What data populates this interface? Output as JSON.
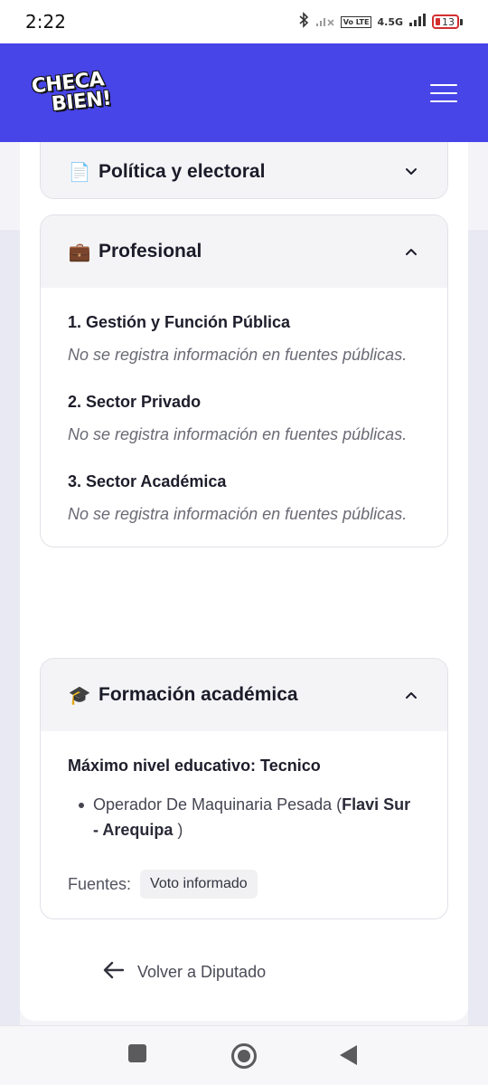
{
  "status_bar": {
    "time": "2:22",
    "bluetooth_icon": "bluetooth-icon",
    "volte_label": "Vo LTE",
    "network_label": "4.5G",
    "battery_level": "13"
  },
  "header": {
    "logo_line1": "CHECA",
    "logo_line2": "BIEN!",
    "brand_color": "#4744e8"
  },
  "sections": {
    "politica": {
      "emoji": "📄",
      "title": "Política y electoral"
    },
    "profesional": {
      "emoji": "💼",
      "title": "Profesional",
      "items": [
        {
          "title": "1. Gestión y Función Pública",
          "text": "No se registra información en fuentes públicas."
        },
        {
          "title": "2. Sector Privado",
          "text": "No se registra información en fuentes públicas."
        },
        {
          "title": "3. Sector Académica",
          "text": "No se registra información en fuentes públicas."
        }
      ]
    },
    "formacion": {
      "emoji": "🎓",
      "title": "Formación académica",
      "level": "Máximo nivel educativo: Tecnico",
      "item_prefix": "Operador De Maquinaria Pesada (",
      "item_bold": "Flavi Sur - Arequipa",
      "item_suffix": " )",
      "sources_label": "Fuentes:",
      "source_chip": "Voto informado"
    }
  },
  "back_link": {
    "label": "Volver a Diputado"
  }
}
